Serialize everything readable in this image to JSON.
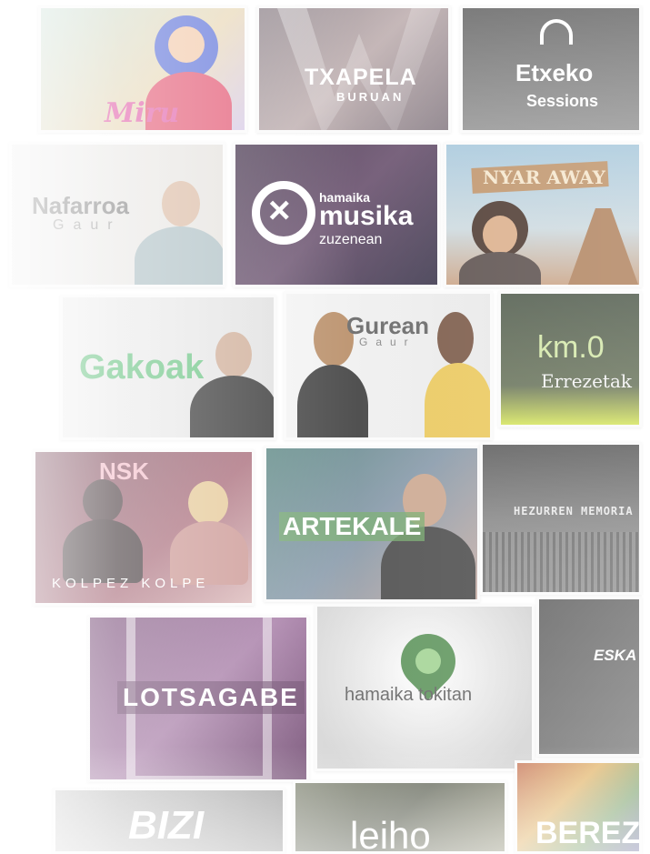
{
  "tiles": {
    "miru": {
      "label": "Miru"
    },
    "txapela": {
      "line1": "TXAPELA",
      "line2": "BURUAN"
    },
    "etxeko": {
      "line1": "Etxeko",
      "line2": "Sessions"
    },
    "nafarroa": {
      "line1": "Nafarroa",
      "line2": "Gaur"
    },
    "musika": {
      "line1": "hamaika",
      "line2": "musika",
      "line3": "zuzenean"
    },
    "nyarway": {
      "label": "NYAR AWAY"
    },
    "gakoak": {
      "label": "Gakoak"
    },
    "gurean": {
      "line1": "Gurean",
      "line2": "Gaur"
    },
    "km0": {
      "line1": "km.0",
      "line2": "Errezetak"
    },
    "kolpez": {
      "top": "NSK",
      "label": "KOLPEZ KOLPE"
    },
    "artekale": {
      "label": "ARTEKALE"
    },
    "hezurren": {
      "label": "HEZURREN MEMORIA"
    },
    "lotsagabe": {
      "label": "LOTSAGABE"
    },
    "hamaikatokitan": {
      "label": "hamaika tokitan"
    },
    "eskaf": {
      "label": "ESKA"
    },
    "bizi": {
      "label": "BIZI"
    },
    "leiho": {
      "label": "leiho"
    },
    "berez": {
      "label": "BEREZ"
    }
  }
}
